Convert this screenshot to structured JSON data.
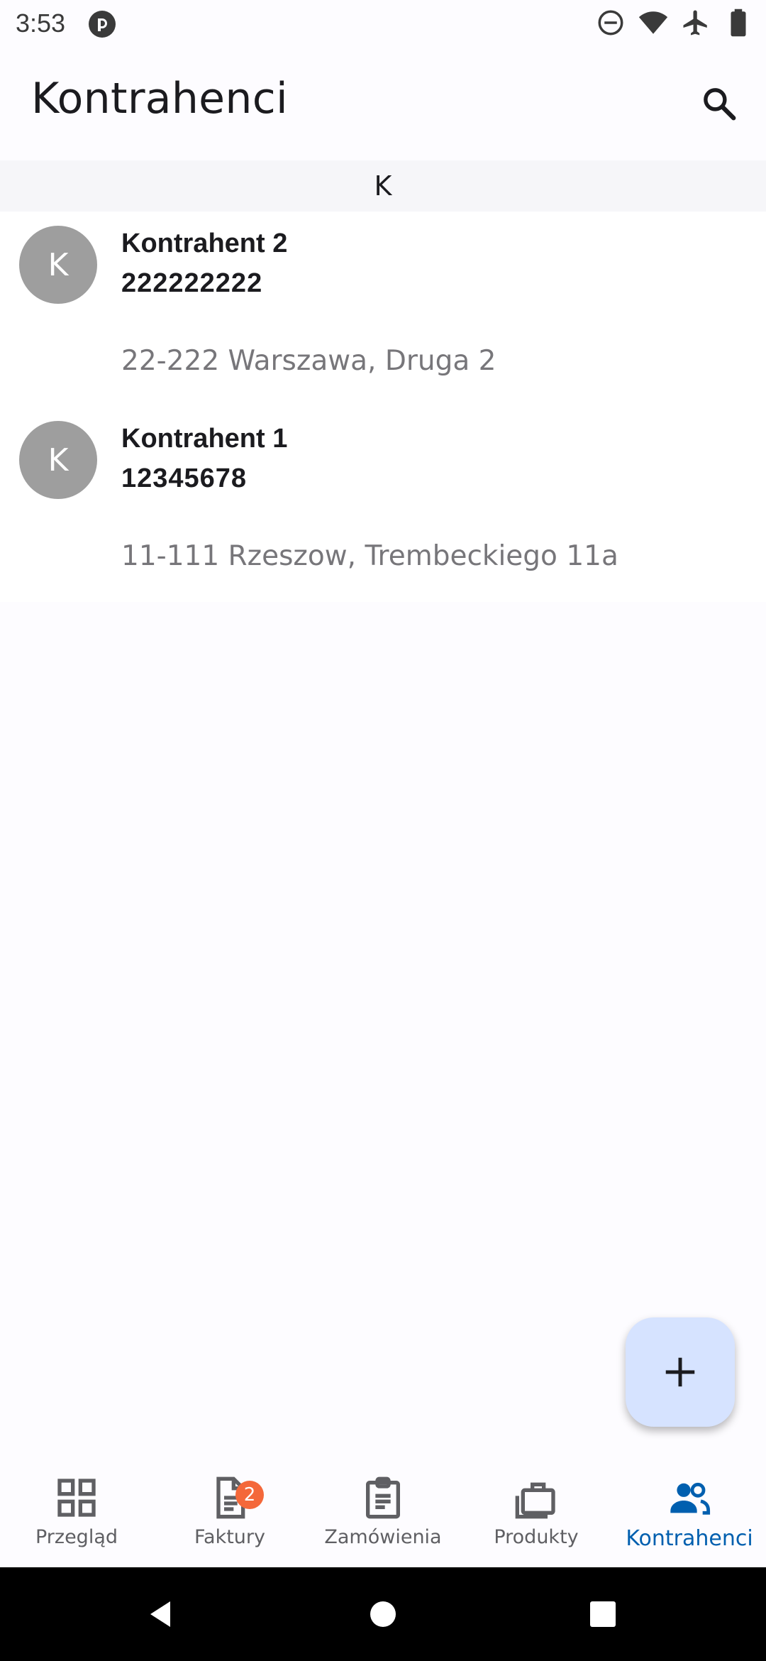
{
  "status_bar": {
    "time": "3:53",
    "icons": [
      "app-notification-icon",
      "do-not-disturb-icon",
      "wifi-icon",
      "airplane-icon",
      "battery-icon"
    ]
  },
  "app_bar": {
    "title": "Kontrahenci",
    "search_icon": "search-icon"
  },
  "list": {
    "section_letter": "K",
    "items": [
      {
        "avatar_letter": "K",
        "name": "Kontrahent 2",
        "number": "222222222",
        "address": "22-222 Warszawa, Druga 2"
      },
      {
        "avatar_letter": "K",
        "name": "Kontrahent 1",
        "number": "12345678",
        "address": "11-111 Rzeszow, Trembeckiego 11a"
      }
    ]
  },
  "fab": {
    "icon": "add-icon"
  },
  "bottom_nav": {
    "items": [
      {
        "label": "Przegląd",
        "icon": "dashboard-icon"
      },
      {
        "label": "Faktury",
        "icon": "document-icon",
        "badge": "2"
      },
      {
        "label": "Zamówienia",
        "icon": "clipboard-icon"
      },
      {
        "label": "Produkty",
        "icon": "briefcase-icon"
      },
      {
        "label": "Kontrahenci",
        "icon": "people-icon",
        "active": true
      }
    ]
  },
  "colors": {
    "accent": "#005faf",
    "fab_background": "#d6e3ff",
    "badge": "#f4683a",
    "avatar": "#9e9e9e"
  }
}
